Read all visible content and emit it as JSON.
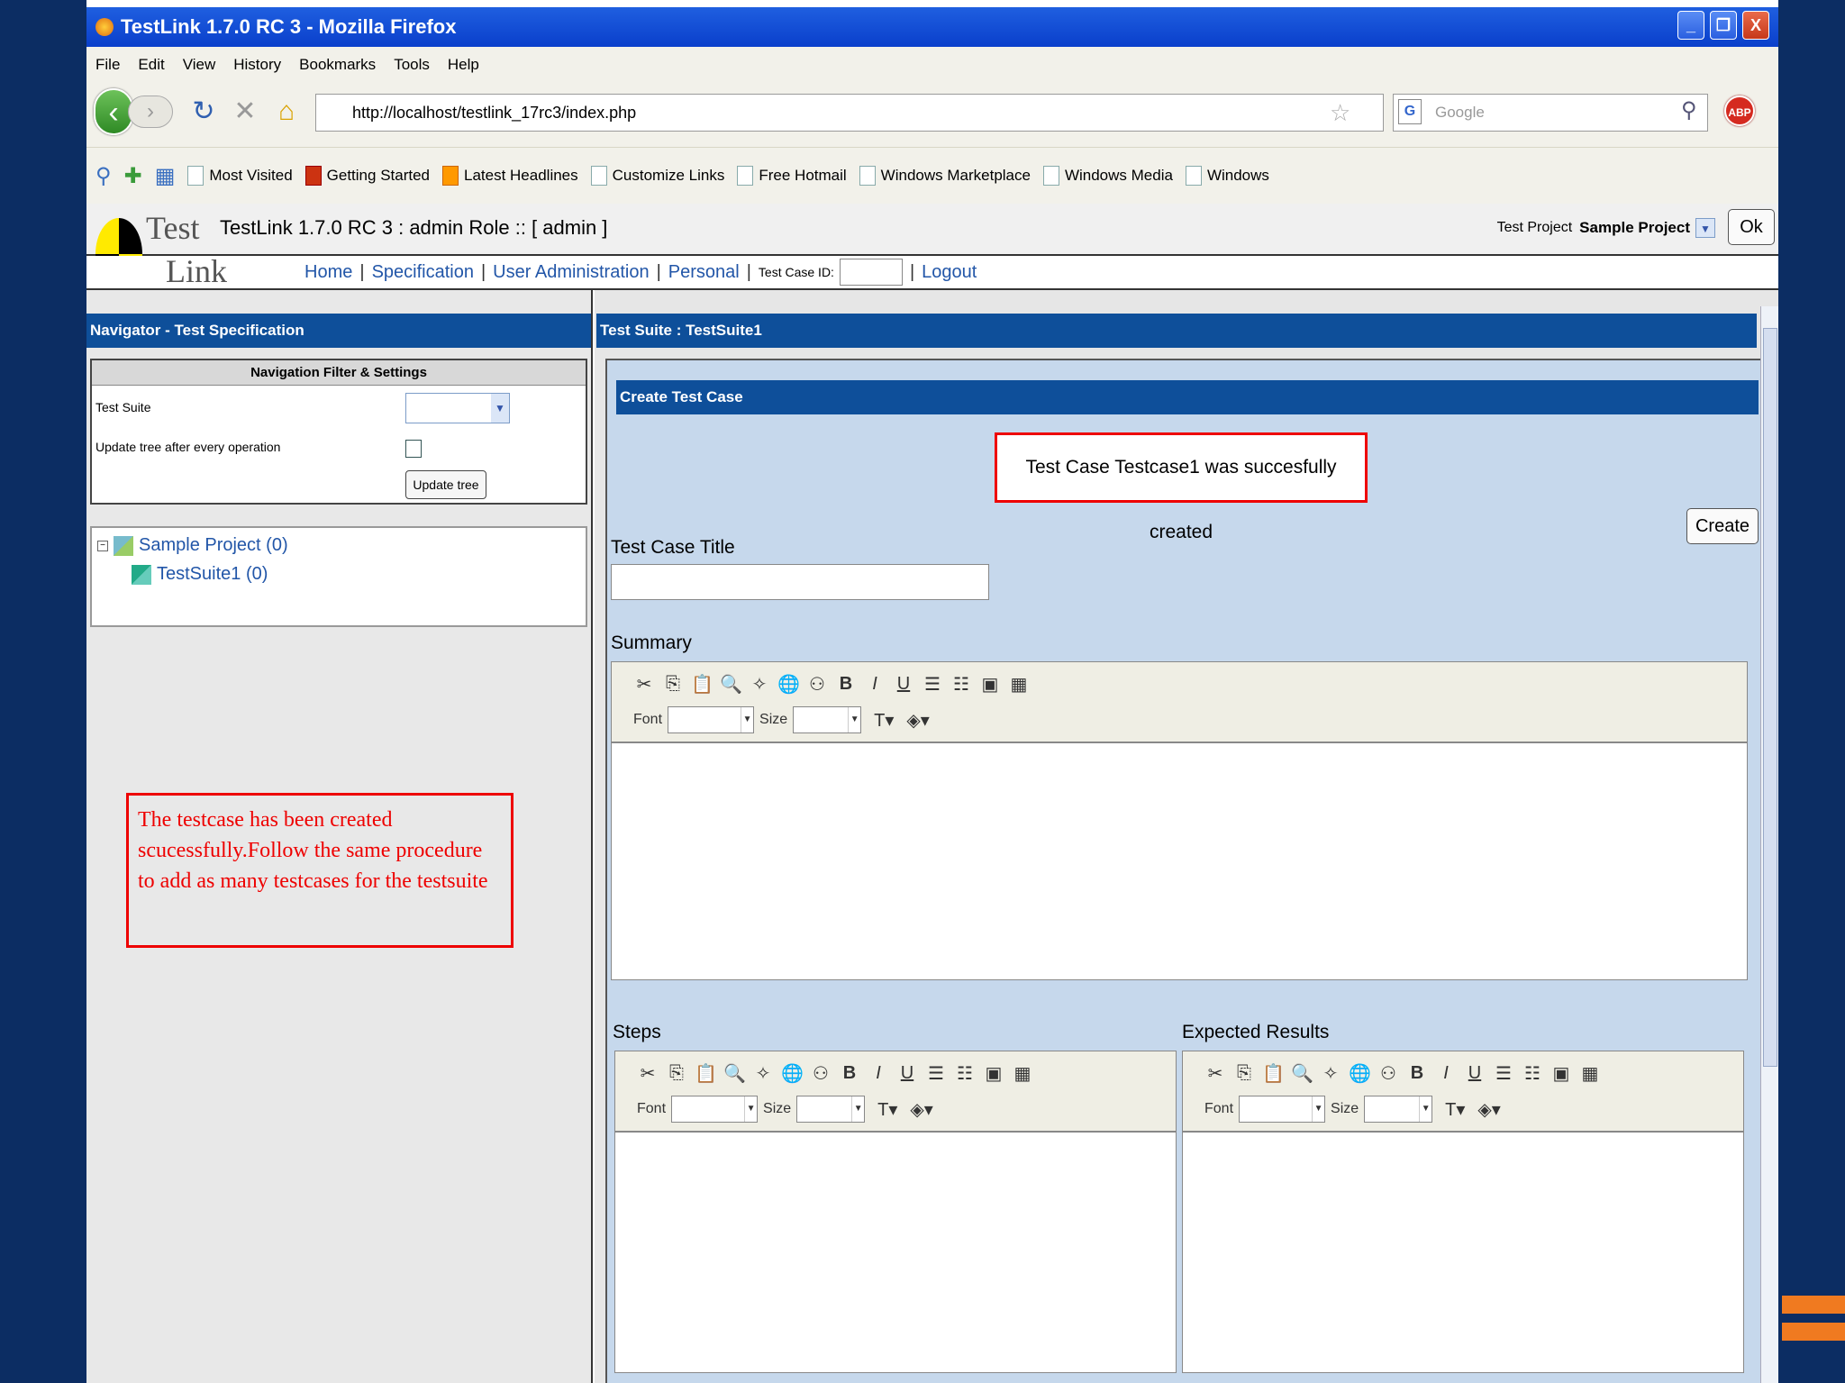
{
  "window": {
    "title": "TestLink 1.7.0 RC 3 - Mozilla Firefox",
    "minimize": "_",
    "restore": "❐",
    "close": "X"
  },
  "menu": {
    "items": [
      "File",
      "Edit",
      "View",
      "History",
      "Bookmarks",
      "Tools",
      "Help"
    ]
  },
  "nav": {
    "url": "http://localhost/testlink_17rc3/index.php",
    "search_placeholder": "Google",
    "abp_label": "ABP"
  },
  "bookmarks": {
    "items": [
      "Most Visited",
      "Getting Started",
      "Latest Headlines",
      "Customize Links",
      "Free Hotmail",
      "Windows Marketplace",
      "Windows Media",
      "Windows"
    ]
  },
  "testlink": {
    "logo_top": "Test",
    "logo_bottom": "Link",
    "header_title": "TestLink 1.7.0 RC 3 : admin Role :: [ admin ]",
    "project_label": "Test Project",
    "project_value": "Sample Project",
    "ok_label": "Ok",
    "nav": {
      "home": "Home",
      "specification": "Specification",
      "user_admin": "User Administration",
      "personal": "Personal",
      "test_case_id": "Test Case ID:",
      "logout": "Logout"
    }
  },
  "navigator": {
    "title": "Navigator - Test Specification",
    "filter_title": "Navigation Filter & Settings",
    "test_suite_label": "Test Suite",
    "update_tree_label": "Update tree after every operation",
    "update_button": "Update tree",
    "tree": {
      "project": "Sample Project (0)",
      "suite": "TestSuite1 (0)"
    }
  },
  "annotation": {
    "text": "The testcase has been created scucessfully.Follow the same procedure to add as many testcases for the testsuite"
  },
  "main": {
    "title": "Test Suite : TestSuite1",
    "create_header": "Create Test Case",
    "success_message": "Test Case Testcase1 was succesfully created",
    "create_button": "Create",
    "title_label": "Test Case Title",
    "summary_label": "Summary",
    "steps_label": "Steps",
    "expected_label": "Expected Results",
    "editor": {
      "font_label": "Font",
      "size_label": "Size",
      "tools": [
        "✂",
        "⎘",
        "📋",
        "🔍",
        "✧",
        "🌐",
        "⚇",
        "B",
        "I",
        "U",
        "☰",
        "☷",
        "▣",
        "▦"
      ]
    }
  },
  "colors": {
    "slide_bg": "#0c2d63",
    "pane_header": "#0e4f9a",
    "annotation_red": "#e00000",
    "accent_orange": "#f07a20"
  }
}
